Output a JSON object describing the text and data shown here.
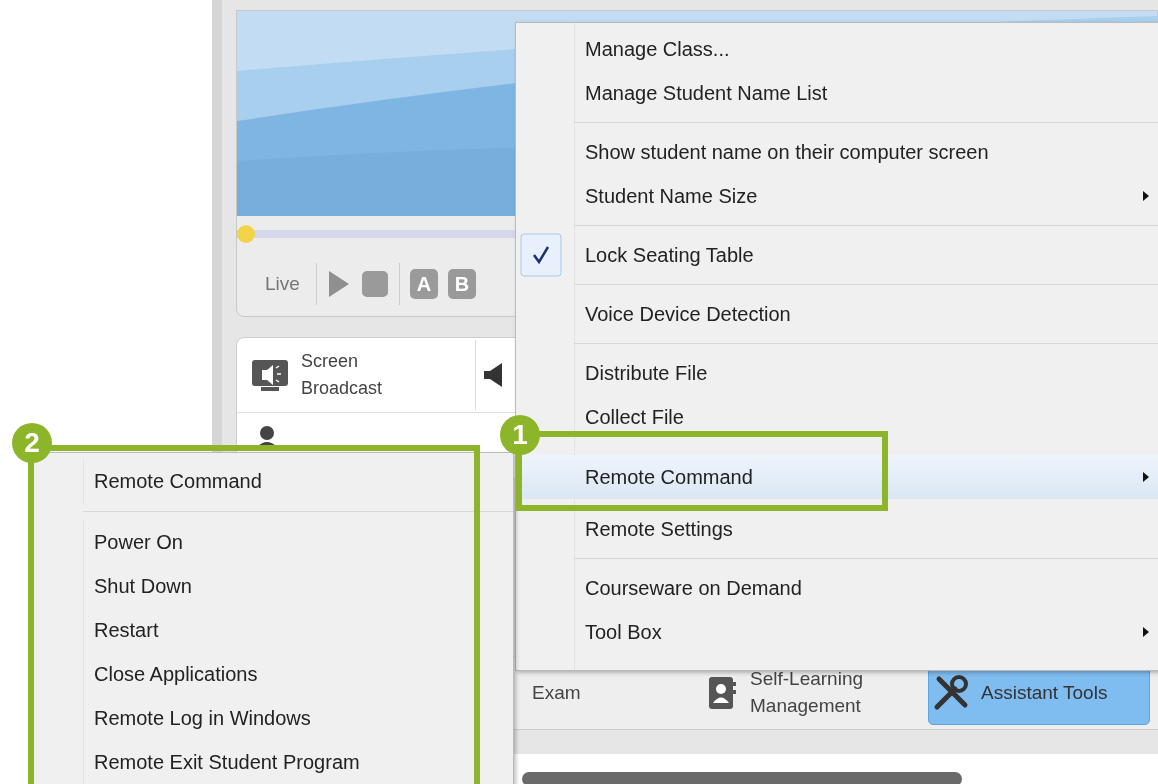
{
  "player": {
    "live_label": "Live",
    "level": 0,
    "buttons": [
      "A",
      "B"
    ]
  },
  "function_tiles": [
    {
      "label": "Screen Broadcast"
    }
  ],
  "toolbar": [
    {
      "label": "Exam",
      "selected": false
    },
    {
      "label": "Self-Learning Management",
      "selected": false
    },
    {
      "label": "Assistant Tools",
      "selected": true
    }
  ],
  "context_menu": {
    "groups": [
      [
        {
          "label": "Manage Class...",
          "checked": false,
          "selected": false,
          "has_submenu": false
        },
        {
          "label": "Manage Student Name List",
          "checked": false,
          "selected": false,
          "has_submenu": false
        }
      ],
      [
        {
          "label": "Show student name on their computer screen",
          "checked": false,
          "selected": false,
          "has_submenu": false
        },
        {
          "label": "Student Name Size",
          "checked": false,
          "selected": false,
          "has_submenu": true
        }
      ],
      [
        {
          "label": "Lock Seating Table",
          "checked": true,
          "selected": false,
          "has_submenu": false
        }
      ],
      [
        {
          "label": "Voice Device Detection",
          "checked": false,
          "selected": false,
          "has_submenu": false
        }
      ],
      [
        {
          "label": "Distribute File",
          "checked": false,
          "selected": false,
          "has_submenu": false
        },
        {
          "label": "Collect File",
          "checked": false,
          "selected": false,
          "has_submenu": false
        },
        {
          "label": "Remote Command",
          "checked": false,
          "selected": true,
          "has_submenu": true
        },
        {
          "label": "Remote Settings",
          "checked": false,
          "selected": false,
          "has_submenu": false
        }
      ],
      [
        {
          "label": "Courseware on Demand",
          "checked": false,
          "selected": false,
          "has_submenu": false
        },
        {
          "label": "Tool Box",
          "checked": false,
          "selected": false,
          "has_submenu": true
        }
      ]
    ]
  },
  "submenu": {
    "title": "Remote Command",
    "items": [
      {
        "label": "Power On"
      },
      {
        "label": "Shut Down"
      },
      {
        "label": "Restart"
      },
      {
        "label": "Close Applications"
      },
      {
        "label": "Remote Log in Windows"
      },
      {
        "label": "Remote Exit Student Program"
      }
    ]
  },
  "callouts": [
    {
      "number": "1"
    },
    {
      "number": "2"
    }
  ]
}
